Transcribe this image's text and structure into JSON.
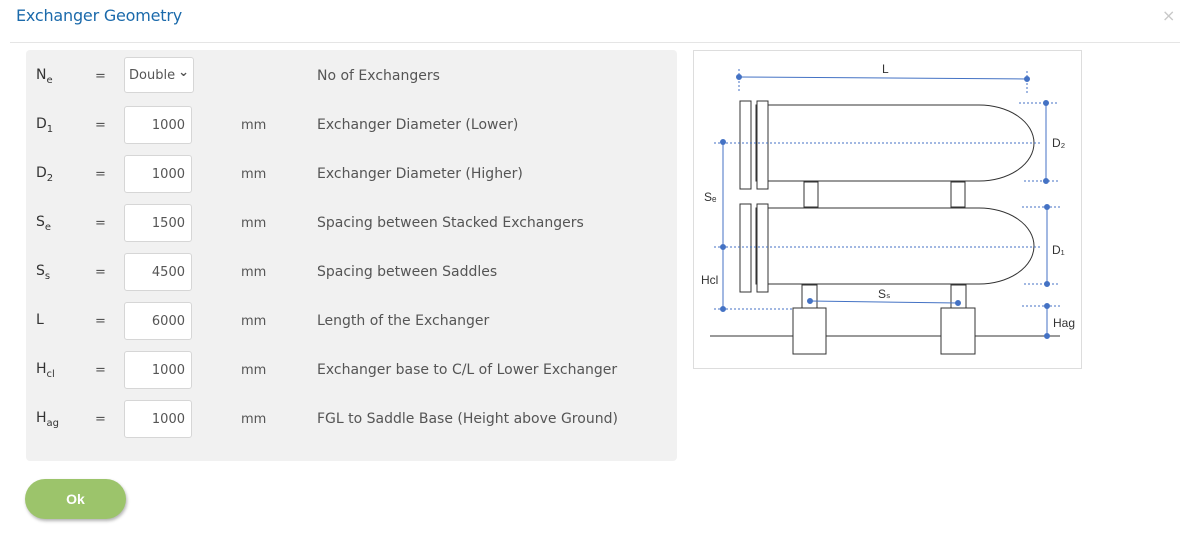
{
  "dialog": {
    "title": "Exchanger Geometry",
    "close_icon": "×",
    "ok_label": "Ok"
  },
  "rows": [
    {
      "sym": "N",
      "sub": "e",
      "eq": "=",
      "value": "Double",
      "type": "select",
      "unit": "",
      "desc": "No of Exchangers"
    },
    {
      "sym": "D",
      "sub": "1",
      "eq": "=",
      "value": "1000",
      "type": "input",
      "unit": "mm",
      "desc": "Exchanger Diameter (Lower)"
    },
    {
      "sym": "D",
      "sub": "2",
      "eq": "=",
      "value": "1000",
      "type": "input",
      "unit": "mm",
      "desc": "Exchanger Diameter (Higher)"
    },
    {
      "sym": "S",
      "sub": "e",
      "eq": "=",
      "value": "1500",
      "type": "input",
      "unit": "mm",
      "desc": "Spacing between Stacked Exchangers"
    },
    {
      "sym": "S",
      "sub": "s",
      "eq": "=",
      "value": "4500",
      "type": "input",
      "unit": "mm",
      "desc": "Spacing between Saddles"
    },
    {
      "sym": "L",
      "sub": "",
      "eq": "=",
      "value": "6000",
      "type": "input",
      "unit": "mm",
      "desc": "Length of the Exchanger"
    },
    {
      "sym": "H",
      "sub": "cl",
      "eq": "=",
      "value": "1000",
      "type": "input",
      "unit": "mm",
      "desc": "Exchanger base to C/L of Lower Exchanger"
    },
    {
      "sym": "H",
      "sub": "ag",
      "eq": "=",
      "value": "1000",
      "type": "input",
      "unit": "mm",
      "desc": "FGL to Saddle Base (Height above Ground)"
    }
  ],
  "diagram": {
    "labels": {
      "L": "L",
      "D2": "D₂",
      "D1": "D₁",
      "Se": "Sₑ",
      "Hcl": "Hcl",
      "Ss": "Sₛ",
      "Hag": "Hag"
    },
    "dim_color": "#4472c4"
  }
}
